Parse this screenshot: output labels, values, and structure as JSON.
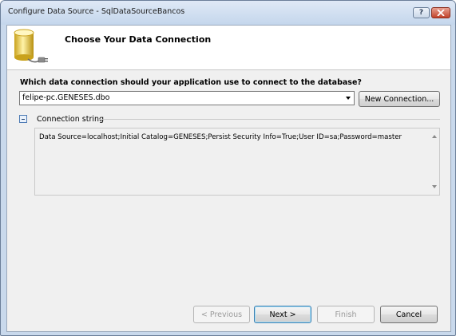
{
  "window": {
    "title": "Configure Data Source - SqlDataSourceBancos",
    "help_label": "?"
  },
  "header": {
    "title": "Choose Your Data Connection",
    "icon": "database-plug-icon"
  },
  "connection": {
    "question": "Which data connection should your application use to connect to the database?",
    "selected": "felipe-pc.GENESES.dbo",
    "new_button": "New Connection..."
  },
  "connection_string": {
    "label": "Connection string",
    "value": "Data Source=localhost;Initial Catalog=GENESES;Persist Security Info=True;User ID=sa;Password=master"
  },
  "footer": {
    "previous": "< Previous",
    "next": "Next >",
    "finish": "Finish",
    "cancel": "Cancel"
  },
  "colors": {
    "title_bar": "#c4d6ec",
    "client_bg": "#f0f0f0",
    "close_button": "#c2432b"
  }
}
